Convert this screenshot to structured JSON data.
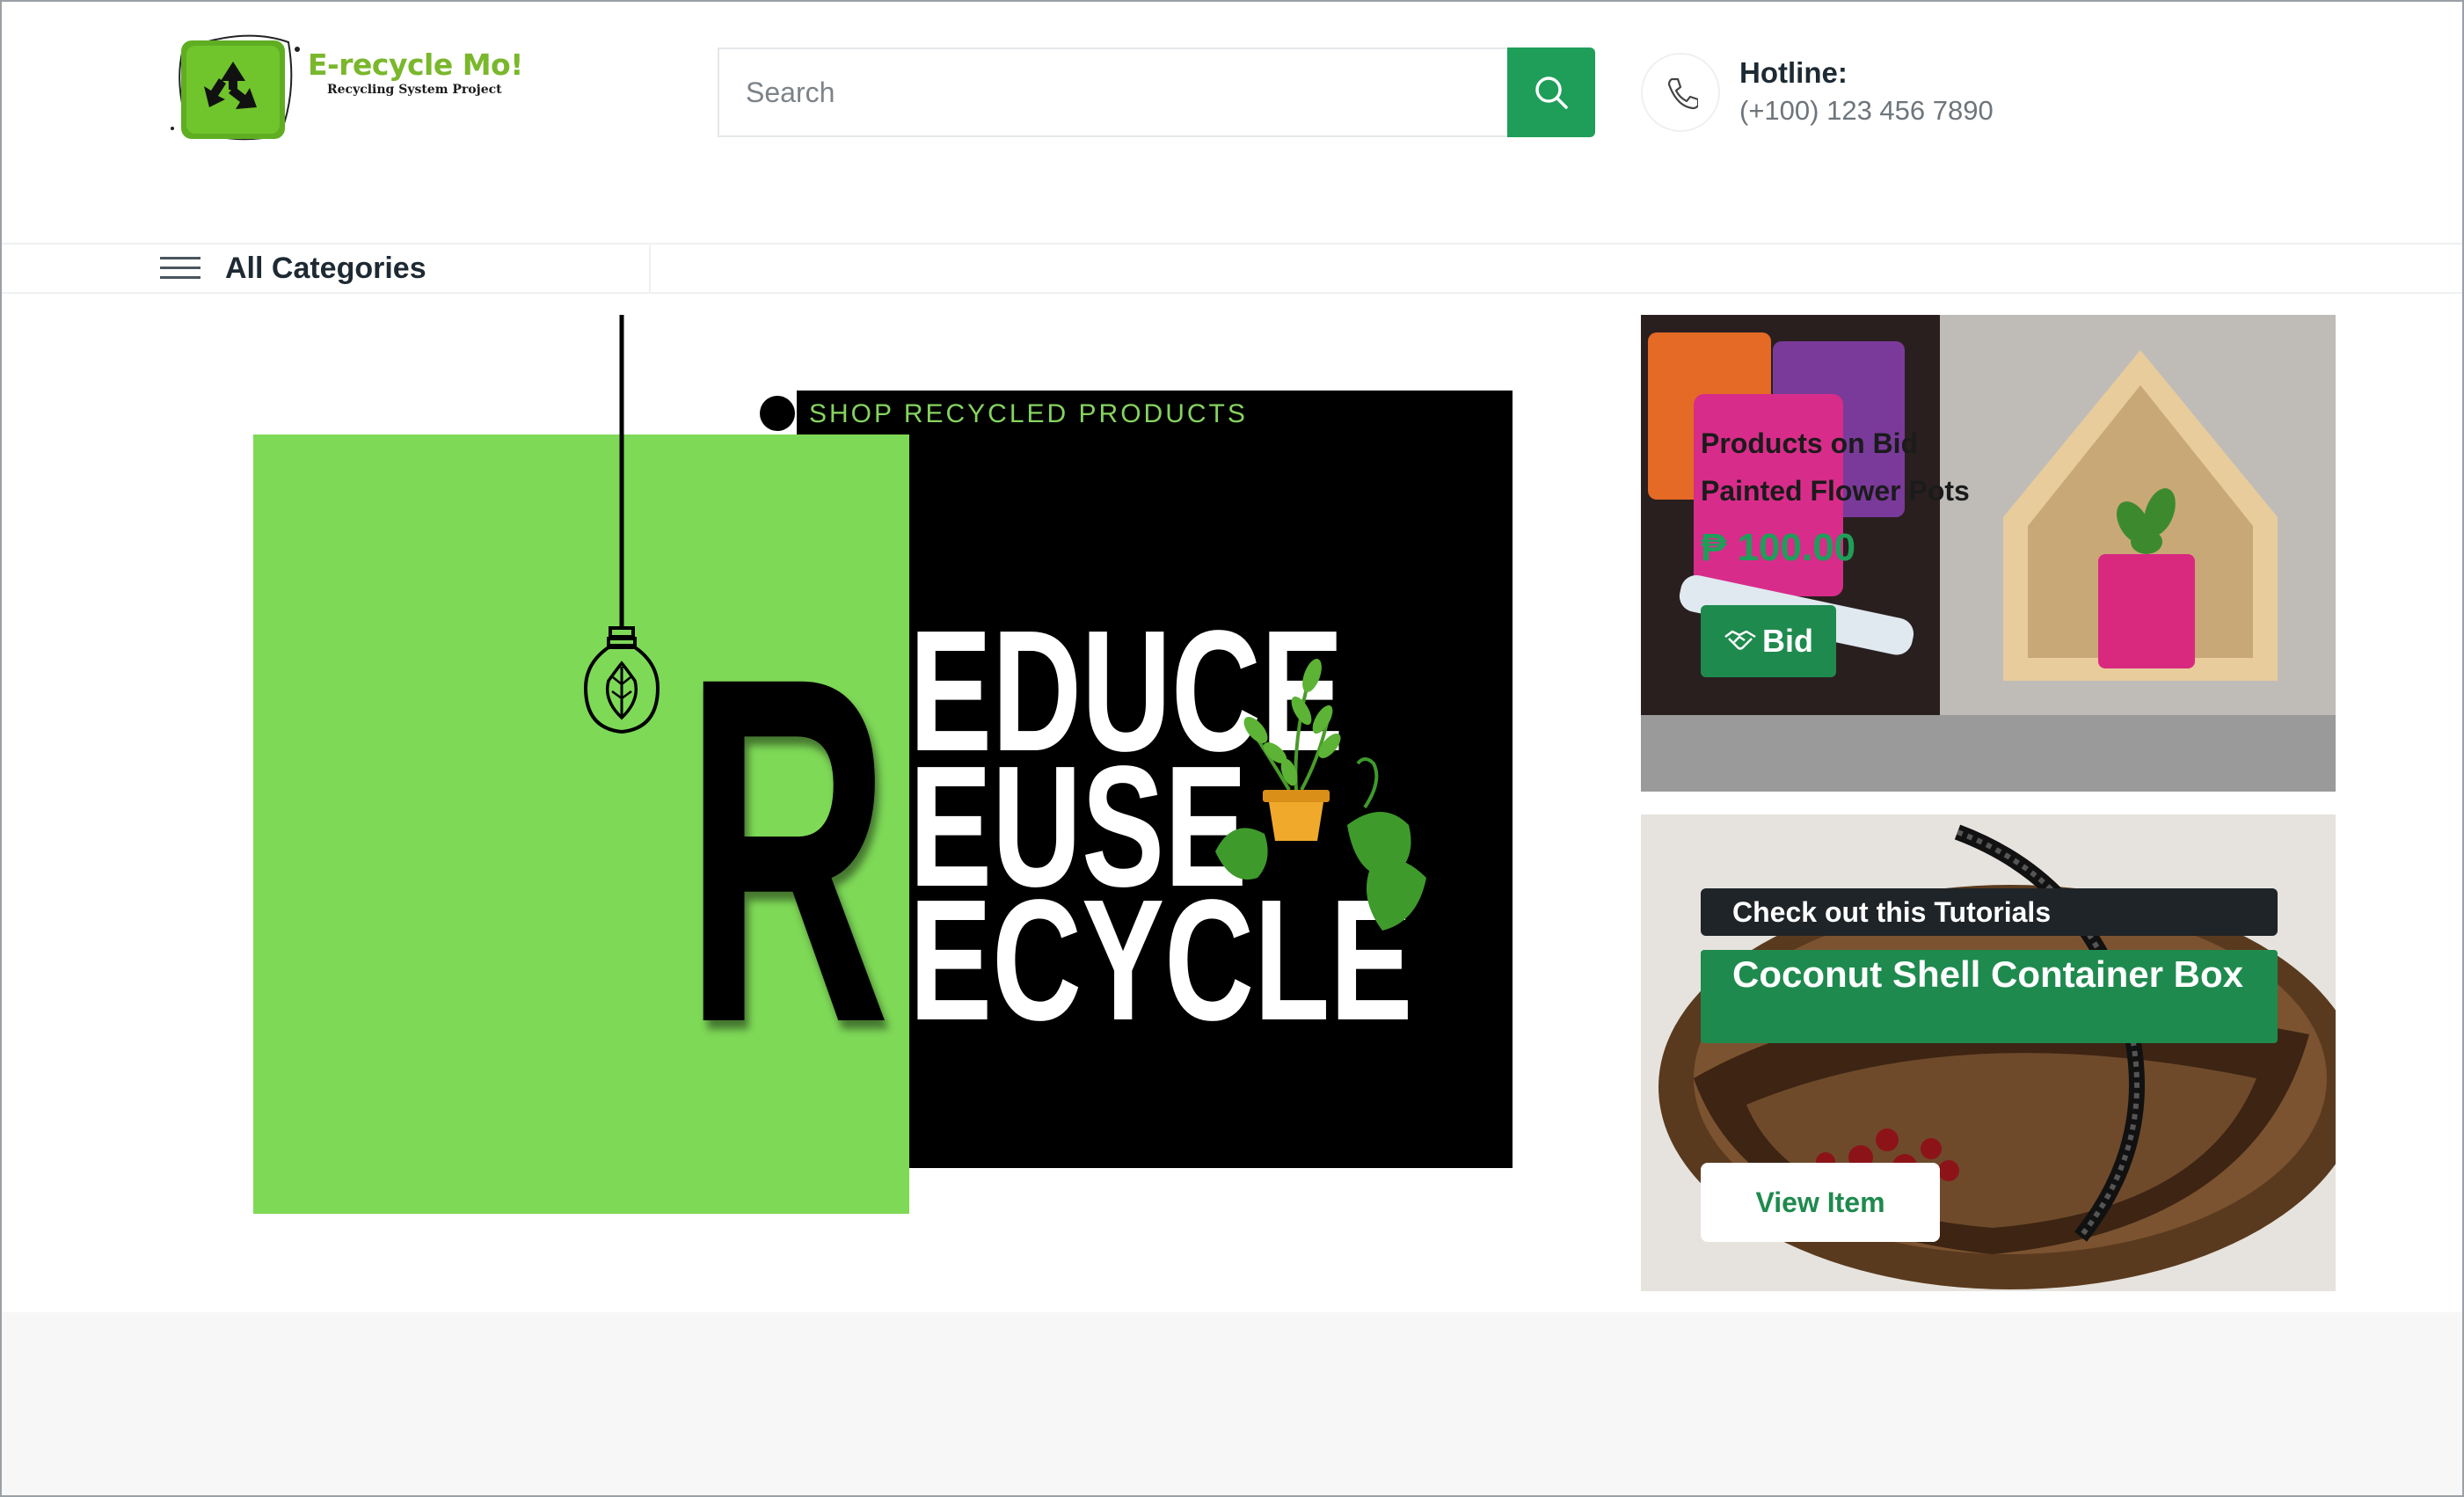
{
  "header": {
    "logo": {
      "title": "E-recycle Mo!",
      "subtitle": "Recycling System Project"
    },
    "search": {
      "placeholder": "Search",
      "value": ""
    },
    "hotline": {
      "label": "Hotline:",
      "number": "(+100) 123 456 7890"
    }
  },
  "nav": {
    "categories_label": "All Categories"
  },
  "hero": {
    "tagline": "SHOP RECYCLED PRODUCTS",
    "big_letter": "R",
    "words": [
      "EDUCE",
      "EUSE",
      "ECYCLE"
    ]
  },
  "promo_bid": {
    "eyebrow": "Products on Bid",
    "title": "Painted Flower Pots",
    "price": "₱ 100.00",
    "button_label": "Bid"
  },
  "promo_tutorial": {
    "eyebrow": "Check out this Tutorials",
    "title": "Coconut Shell Container Box",
    "button_label": "View Item"
  },
  "colors": {
    "brand_green": "#1f9e5a",
    "hero_green": "#7ed957",
    "logo_green": "#7ab72c"
  }
}
